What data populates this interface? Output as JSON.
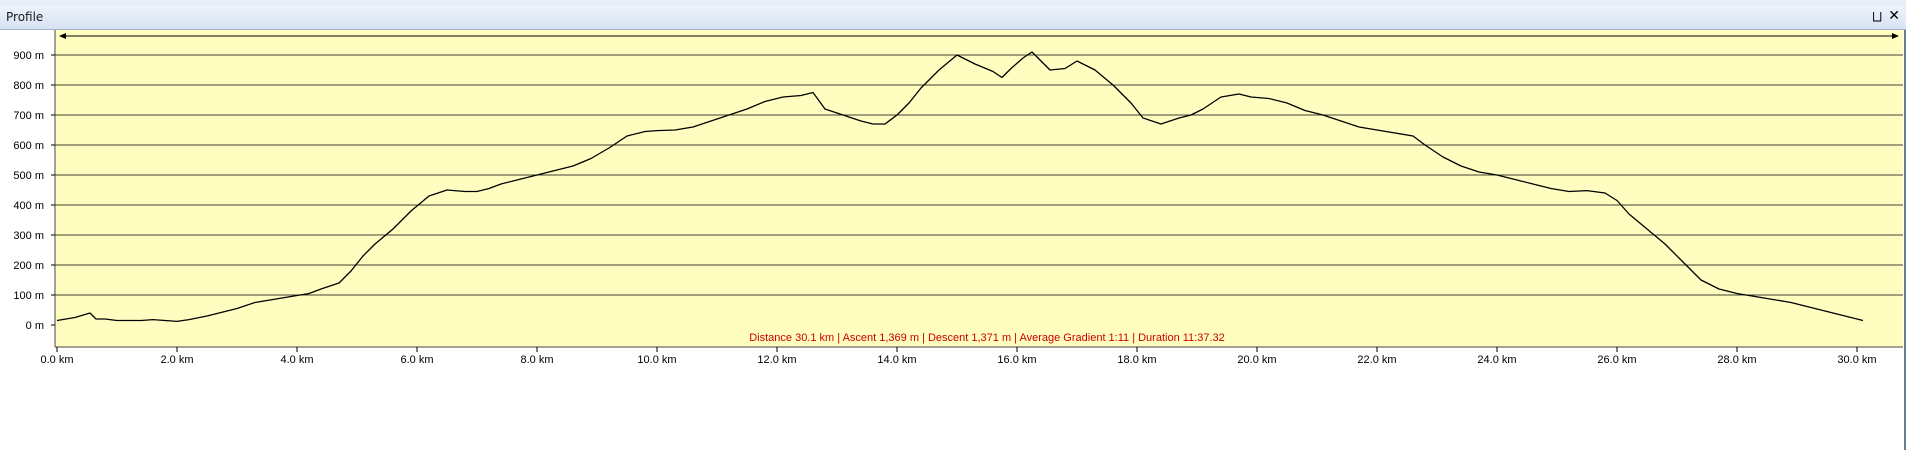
{
  "window": {
    "title": "Profile",
    "pin_glyph": "⨆",
    "close_glyph": "✕"
  },
  "colors": {
    "plot_bg": "#fffec0",
    "line": "#000000",
    "grid": "#000000",
    "summary_text": "#cc0000"
  },
  "chart_data": {
    "type": "area",
    "title": "",
    "xlabel": "",
    "ylabel": "",
    "xlim": [
      0,
      30.1
    ],
    "ylim": [
      -60,
      1000
    ],
    "x_ticks": [
      0,
      2,
      4,
      6,
      8,
      10,
      12,
      14,
      16,
      18,
      20,
      22,
      24,
      26,
      28,
      30
    ],
    "x_tick_labels": [
      "0.0 km",
      "2.0 km",
      "4.0 km",
      "6.0 km",
      "8.0 km",
      "10.0 km",
      "12.0 km",
      "14.0 km",
      "16.0 km",
      "18.0 km",
      "20.0 km",
      "22.0 km",
      "24.0 km",
      "26.0 km",
      "28.0 km",
      "30.0 km"
    ],
    "y_ticks": [
      0,
      100,
      200,
      300,
      400,
      500,
      600,
      700,
      800,
      900
    ],
    "y_tick_labels": [
      "0 m",
      "100 m",
      "200 m",
      "300 m",
      "400 m",
      "500 m",
      "600 m",
      "700 m",
      "800 m",
      "900 m"
    ],
    "grid": "horizontal",
    "legend": "none",
    "summary": "Distance 30.1 km | Ascent 1,369 m | Descent 1,371 m | Average Gradient 1:11 | Duration 11:37.32",
    "series": [
      {
        "x": [
          0,
          0.3,
          0.55,
          0.65,
          0.8,
          1.0,
          1.2,
          1.4,
          1.6,
          1.8,
          2.0,
          2.2,
          2.5,
          2.8,
          3.0,
          3.3,
          3.6,
          3.9,
          4.2,
          4.4,
          4.7,
          4.9,
          5.1,
          5.3,
          5.6,
          5.9,
          6.2,
          6.5,
          6.8,
          7.0,
          7.2,
          7.4,
          7.7,
          8.0,
          8.3,
          8.6,
          8.9,
          9.2,
          9.5,
          9.8,
          10.0,
          10.3,
          10.6,
          10.9,
          11.2,
          11.5,
          11.8,
          12.1,
          12.4,
          12.6,
          12.8,
          13.1,
          13.4,
          13.6,
          13.8,
          14.0,
          14.2,
          14.4,
          14.7,
          15.0,
          15.3,
          15.6,
          15.75,
          15.9,
          16.1,
          16.25,
          16.4,
          16.55,
          16.8,
          17.0,
          17.3,
          17.6,
          17.9,
          18.1,
          18.4,
          18.7,
          18.9,
          19.1,
          19.4,
          19.7,
          19.9,
          20.2,
          20.5,
          20.8,
          21.1,
          21.4,
          21.7,
          22.0,
          22.3,
          22.6,
          22.8,
          23.1,
          23.4,
          23.7,
          24.0,
          24.3,
          24.6,
          24.9,
          25.2,
          25.5,
          25.8,
          26.0,
          26.2,
          26.5,
          26.8,
          27.1,
          27.4,
          27.7,
          28.0,
          28.3,
          28.6,
          28.9,
          29.2,
          29.5,
          29.8,
          30.1
        ],
        "y": [
          15,
          25,
          40,
          20,
          20,
          15,
          15,
          15,
          18,
          15,
          12,
          18,
          30,
          45,
          55,
          75,
          85,
          95,
          105,
          120,
          140,
          180,
          230,
          270,
          320,
          380,
          430,
          450,
          445,
          445,
          455,
          470,
          485,
          500,
          515,
          530,
          555,
          590,
          630,
          645,
          648,
          650,
          660,
          680,
          700,
          720,
          745,
          760,
          765,
          775,
          720,
          700,
          680,
          670,
          670,
          700,
          740,
          790,
          850,
          900,
          870,
          845,
          825,
          855,
          890,
          910,
          880,
          850,
          855,
          880,
          850,
          800,
          740,
          690,
          670,
          690,
          700,
          720,
          760,
          770,
          760,
          755,
          740,
          715,
          700,
          680,
          660,
          650,
          640,
          630,
          600,
          560,
          530,
          510,
          500,
          485,
          470,
          455,
          445,
          448,
          440,
          415,
          370,
          320,
          270,
          210,
          150,
          120,
          105,
          95,
          85,
          75,
          60,
          45,
          30,
          15
        ]
      }
    ]
  }
}
